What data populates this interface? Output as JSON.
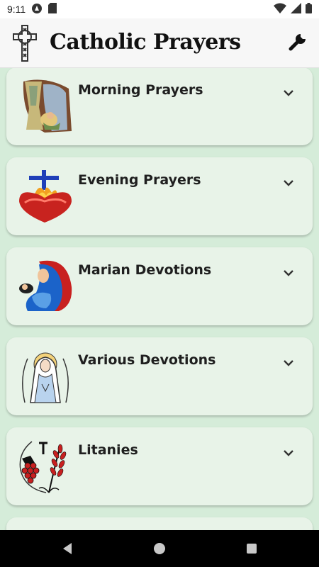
{
  "status": {
    "time": "9:11"
  },
  "app": {
    "title": "Catholic Prayers"
  },
  "categories": [
    {
      "label": "Morning Prayers",
      "icon": "nativity-icon"
    },
    {
      "label": "Evening Prayers",
      "icon": "sacred-heart-icon"
    },
    {
      "label": "Marian Devotions",
      "icon": "madonna-icon"
    },
    {
      "label": "Various Devotions",
      "icon": "virgin-mary-halo-icon"
    },
    {
      "label": "Litanies",
      "icon": "grapes-wheat-icon"
    },
    {
      "label": "",
      "icon": ""
    }
  ],
  "colors": {
    "card": "#e8f3e8",
    "background": "#d5ecd9",
    "appbar": "#f7f7f7"
  }
}
